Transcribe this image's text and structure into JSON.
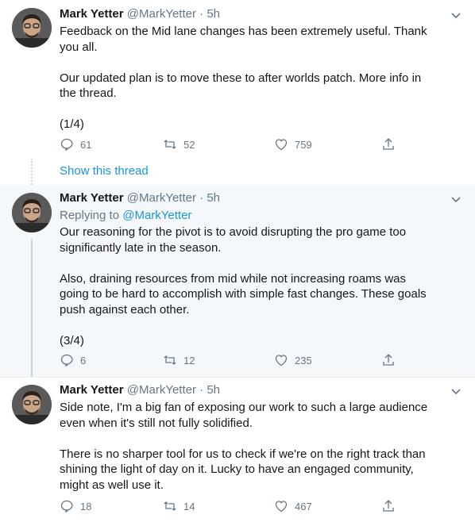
{
  "tweets": [
    {
      "author_name": "Mark Yetter",
      "author_handle": "@MarkYetter",
      "separator": "·",
      "time": "5h",
      "replying_label": "",
      "replying_handle": "",
      "paragraphs": [
        [
          "Feedback on the Mid lane changes has been extremely useful. Thank",
          "you all."
        ],
        [
          "Our updated plan is to move these to after worlds patch. More info in",
          "the thread."
        ],
        [
          "(1/4)"
        ]
      ],
      "replies": "61",
      "retweets": "52",
      "likes": "759"
    },
    {
      "author_name": "Mark Yetter",
      "author_handle": "@MarkYetter",
      "separator": "·",
      "time": "5h",
      "replying_label": "Replying to",
      "replying_handle": "@MarkYetter",
      "paragraphs": [
        [
          "Our reasoning for the pivot is to avoid disrupting the pro game too",
          "significantly late in the season."
        ],
        [
          "Also, draining resources from mid while not increasing roams was",
          "going to be hard to accomplish with simple fast changes. These goals",
          "push against each other."
        ],
        [
          "(3/4)"
        ]
      ],
      "replies": "6",
      "retweets": "12",
      "likes": "235"
    },
    {
      "author_name": "Mark Yetter",
      "author_handle": "@MarkYetter",
      "separator": "·",
      "time": "5h",
      "replying_label": "",
      "replying_handle": "",
      "paragraphs": [
        [
          "Side  note, I'm a big fan of exposing our work to such a large audience",
          "even when it's still not fully solidified."
        ],
        [
          "There is no sharper tool for us to check if we're on the right track than",
          "shining the light of day on it. Lucky to have an engaged community,",
          "might as well use it."
        ]
      ],
      "replies": "18",
      "retweets": "14",
      "likes": "467"
    }
  ],
  "show_thread": "Show this thread",
  "colors": {
    "accent": "#1b95e0",
    "secondary": "#657786",
    "thread_bg": "#f5f8fa"
  }
}
